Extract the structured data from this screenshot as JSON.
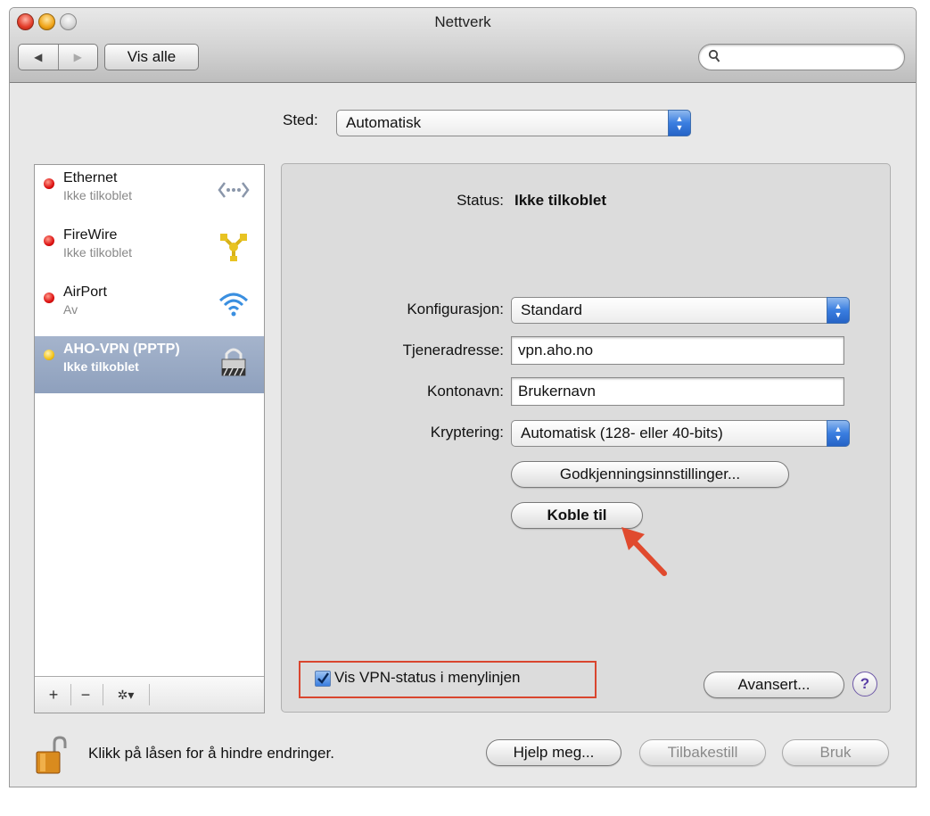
{
  "window": {
    "title": "Nettverk"
  },
  "toolbar": {
    "back_label": "◀",
    "forward_label": "▶",
    "show_all_label": "Vis alle",
    "search_placeholder": ""
  },
  "location": {
    "label": "Sted:",
    "value": "Automatisk"
  },
  "services": [
    {
      "name": "Ethernet",
      "status": "Ikke tilkoblet",
      "dot": "red",
      "icon": "ethernet-icon",
      "selected": false
    },
    {
      "name": "FireWire",
      "status": "Ikke tilkoblet",
      "dot": "red",
      "icon": "firewire-icon",
      "selected": false
    },
    {
      "name": "AirPort",
      "status": "Av",
      "dot": "red",
      "icon": "wifi-icon",
      "selected": false
    },
    {
      "name": "AHO-VPN (PPTP)",
      "status": "Ikke tilkoblet",
      "dot": "yellow",
      "icon": "vpn-lock-icon",
      "selected": true
    }
  ],
  "sidebar_controls": {
    "add": "+",
    "remove": "−",
    "gear": "✲▾"
  },
  "detail": {
    "status_label": "Status:",
    "status_value": "Ikke tilkoblet",
    "config_label": "Konfigurasjon:",
    "config_value": "Standard",
    "server_label": "Tjeneradresse:",
    "server_value": "vpn.aho.no",
    "account_label": "Kontonavn:",
    "account_value": "Brukernavn",
    "encryption_label": "Kryptering:",
    "encryption_value": "Automatisk (128- eller 40-bits)",
    "auth_settings_button": "Godkjenningsinnstillinger...",
    "connect_button": "Koble til",
    "show_vpn_status_label": "Vis VPN-status i menylinjen",
    "show_vpn_status_checked": true,
    "advanced_button": "Avansert...",
    "help_glyph": "?"
  },
  "footer": {
    "lock_text": "Klikk på låsen for å hindre endringer.",
    "assist_button": "Hjelp meg...",
    "revert_button": "Tilbakestill",
    "apply_button": "Bruk"
  },
  "colors": {
    "selection": "#8ea0bd",
    "highlight_annotation": "#d9462f",
    "popup_accent": "#3a7ee0"
  }
}
